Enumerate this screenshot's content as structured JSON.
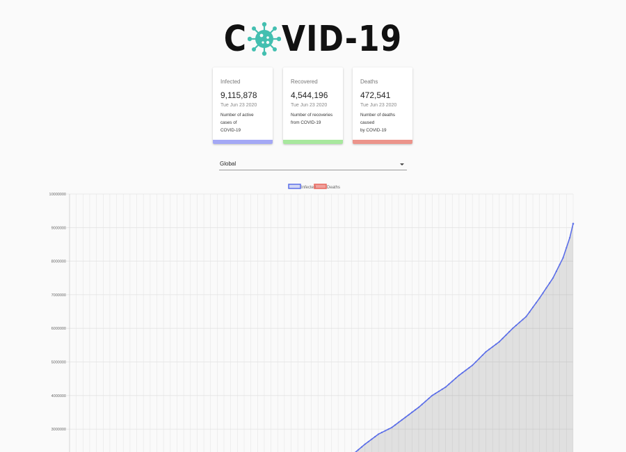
{
  "header": {
    "logo_left": "C",
    "logo_right": "VID-19",
    "logo_alt": "COVID-19"
  },
  "cards": [
    {
      "label": "Infected",
      "count": "9,115,878",
      "date": "Tue Jun 23 2020",
      "desc_line1": "Number of active cases of",
      "desc_line2": "COVID-19",
      "bar_color": "#a4a8f5"
    },
    {
      "label": "Recovered",
      "count": "4,544,196",
      "date": "Tue Jun 23 2020",
      "desc_line1": "Number of recoveries",
      "desc_line2": "from COVID-19",
      "bar_color": "#a8e89e"
    },
    {
      "label": "Deaths",
      "count": "472,541",
      "date": "Tue Jun 23 2020",
      "desc_line1": "Number of deaths caused",
      "desc_line2": "by COVID-19",
      "bar_color": "#ec948b"
    }
  ],
  "country_select": {
    "value": "Global"
  },
  "chart_data": {
    "type": "line",
    "legend": [
      "Infected",
      "Deaths"
    ],
    "legend_position": "top",
    "series": [
      {
        "name": "Infected",
        "color": "#5b6ee8",
        "fill": "rgba(0,0,0,0.1)",
        "x_index_range": [
          0,
          149
        ],
        "values_visible_tail": [
          {
            "i": 85,
            "y": 2300000
          },
          {
            "i": 88,
            "y": 2550000
          },
          {
            "i": 92,
            "y": 2850000
          },
          {
            "i": 96,
            "y": 3050000
          },
          {
            "i": 100,
            "y": 3350000
          },
          {
            "i": 104,
            "y": 3650000
          },
          {
            "i": 108,
            "y": 4000000
          },
          {
            "i": 112,
            "y": 4250000
          },
          {
            "i": 116,
            "y": 4600000
          },
          {
            "i": 120,
            "y": 4900000
          },
          {
            "i": 124,
            "y": 5300000
          },
          {
            "i": 128,
            "y": 5600000
          },
          {
            "i": 132,
            "y": 6000000
          },
          {
            "i": 136,
            "y": 6350000
          },
          {
            "i": 140,
            "y": 6900000
          },
          {
            "i": 144,
            "y": 7500000
          },
          {
            "i": 147,
            "y": 8100000
          },
          {
            "i": 149,
            "y": 8700000
          },
          {
            "i": 150,
            "y": 9115878
          }
        ]
      },
      {
        "name": "Deaths",
        "color": "#e8665d"
      }
    ],
    "y_ticks": [
      "10000000",
      "9000000",
      "8000000",
      "7000000",
      "6000000",
      "5000000",
      "4000000",
      "3000000"
    ],
    "ylim": [
      0,
      10000000
    ],
    "grid": true
  }
}
